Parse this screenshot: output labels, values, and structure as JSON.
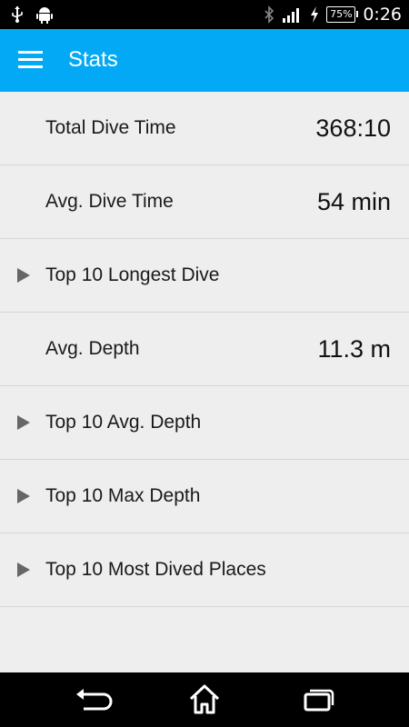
{
  "status_bar": {
    "time": "0:26",
    "battery": "75%",
    "icons": [
      "usb-icon",
      "android-icon",
      "bluetooth-icon",
      "signal-icon",
      "charging-icon",
      "battery-icon"
    ]
  },
  "app_bar": {
    "title": "Stats",
    "color": "#03a9f4"
  },
  "stats": [
    {
      "label": "Total Dive Time",
      "value": "368:10",
      "expandable": false
    },
    {
      "label": "Avg. Dive Time",
      "value": "54 min",
      "expandable": false
    },
    {
      "label": "Top 10 Longest Dive",
      "value": "",
      "expandable": true
    },
    {
      "label": "Avg. Depth",
      "value": "11.3 m",
      "expandable": false
    },
    {
      "label": "Top 10 Avg. Depth",
      "value": "",
      "expandable": true
    },
    {
      "label": "Top 10 Max Depth",
      "value": "",
      "expandable": true
    },
    {
      "label": "Top 10 Most Dived Places",
      "value": "",
      "expandable": true
    }
  ],
  "nav_bar": {
    "icons": [
      "back-icon",
      "home-icon",
      "recents-icon"
    ]
  }
}
